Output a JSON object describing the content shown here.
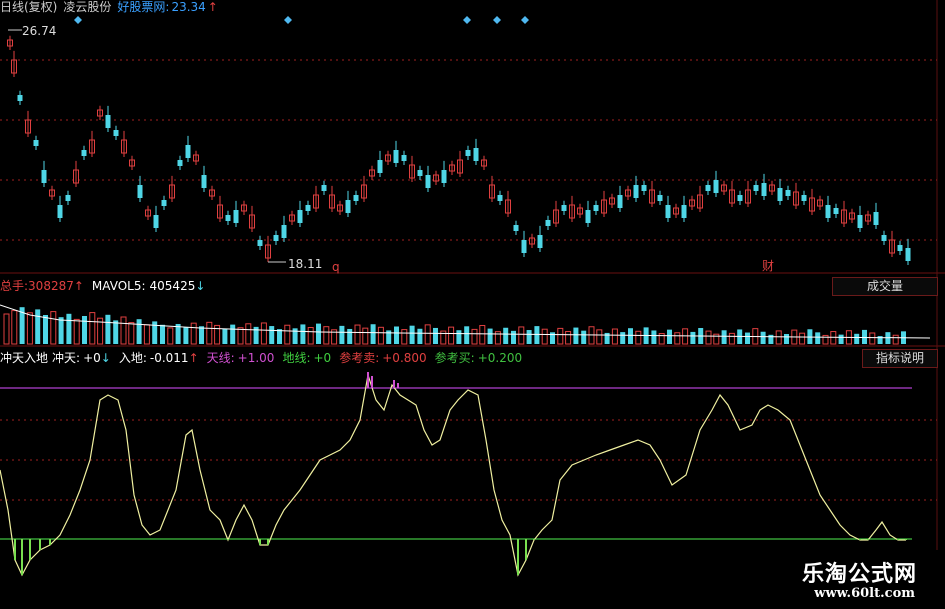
{
  "header": {
    "period_label": "日线(复权)",
    "stock_name": "凌云股份",
    "site_label": "好股票网:",
    "price": "23.34",
    "price_arrow": "↑"
  },
  "price_panel": {
    "high_label": "26.74",
    "low_label": "18.11",
    "marker_q": "q",
    "marker_cai": "财"
  },
  "volume_panel": {
    "total_label": "总手:",
    "total_value": "308287",
    "total_arrow": "↑",
    "mavol_label": "MAVOL5:",
    "mavol_value": "405425",
    "mavol_arrow": "↓",
    "button_label": "成交量"
  },
  "indicator_panel": {
    "name": "冲天入地",
    "chongtian_label": "冲天:",
    "chongtian_value": "+0",
    "chongtian_arrow": "↓",
    "rudi_label": "入地:",
    "rudi_value": "-0.011",
    "rudi_arrow": "↑",
    "tianxian_label": "天线:",
    "tianxian_value": "+1.00",
    "dixian_label": "地线:",
    "dixian_value": "+0",
    "sell_label": "参考卖:",
    "sell_value": "+0.800",
    "buy_label": "参考买:",
    "buy_value": "+0.200",
    "button_label": "指标说明"
  },
  "watermark": {
    "name": "乐淘公式网",
    "url": "www.60lt.com"
  },
  "colors": {
    "up": "#e04040",
    "down": "#4fd6e6",
    "ma_line": "#ffffff",
    "indicator_line": "#f0f0a0",
    "top_line": "#b040d0",
    "bottom_line": "#40c040",
    "dashed": "#a02020",
    "bg": "#000000"
  }
}
